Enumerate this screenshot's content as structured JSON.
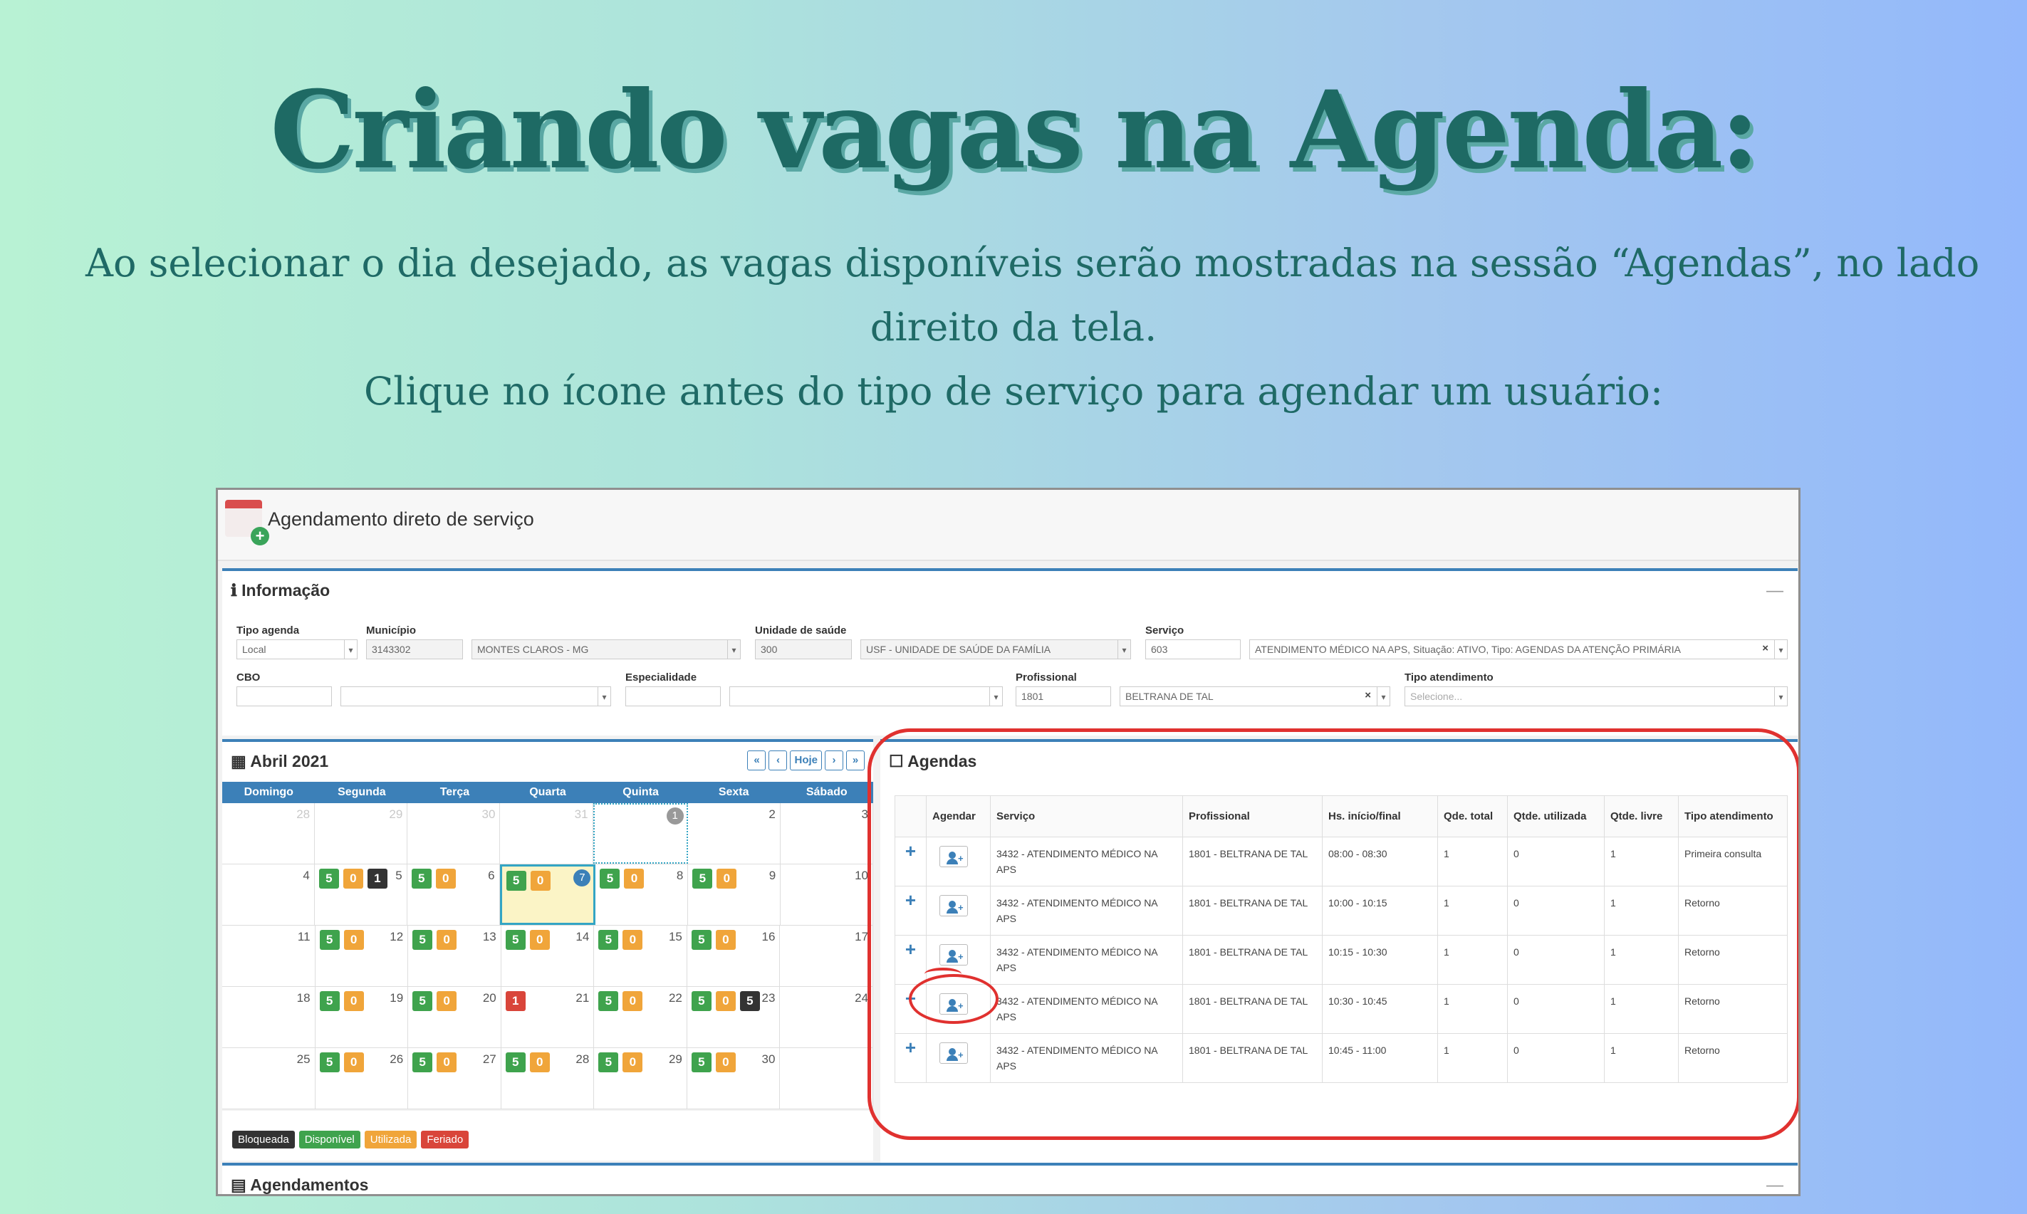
{
  "slide": {
    "headline": "Criando vagas na Agenda:",
    "sub_line1": "Ao selecionar o dia desejado, as vagas disponíveis serão mostradas na sessão “Agendas”, no lado",
    "sub_line2": "direito da tela.",
    "sub_line3": "Clique no ícone antes do tipo de serviço para agendar um usuário:"
  },
  "app": {
    "title": "Agendamento direto de serviço",
    "info": {
      "title": "Informação",
      "tipo_agenda_label": "Tipo agenda",
      "tipo_agenda": "Local",
      "municipio_label": "Município",
      "municipio_code": "3143302",
      "municipio_name": "MONTES CLAROS - MG",
      "unidade_label": "Unidade de saúde",
      "unidade_code": "300",
      "unidade_name": "USF - UNIDADE DE SAÚDE DA FAMÍLIA",
      "servico_label": "Serviço",
      "servico_code": "603",
      "servico_name": "ATENDIMENTO MÉDICO NA APS, Situação: ATIVO, Tipo: AGENDAS DA ATENÇÃO PRIMÁRIA",
      "cbo_label": "CBO",
      "especialidade_label": "Especialidade",
      "profissional_label": "Profissional",
      "profissional_code": "1801",
      "profissional_name": "BELTRANA DE TAL",
      "tipo_atendimento_label": "Tipo atendimento",
      "tipo_atendimento_placeholder": "Selecione..."
    },
    "calendar": {
      "month": "Abril 2021",
      "nav": [
        "«",
        "‹",
        "Hoje",
        "›",
        "»"
      ],
      "weekdays": [
        "Domingo",
        "Segunda",
        "Terça",
        "Quarta",
        "Quinta",
        "Sexta",
        "Sábado"
      ],
      "legend": [
        {
          "label": "Bloqueada",
          "color": "#333333"
        },
        {
          "label": "Disponível",
          "color": "#3fa34d"
        },
        {
          "label": "Utilizada",
          "color": "#f0a53a"
        },
        {
          "label": "Feriado",
          "color": "#d9453a"
        }
      ]
    },
    "agendas": {
      "title": "Agendas",
      "headers": [
        "Agendar",
        "Serviço",
        "Profissional",
        "Hs. início/final",
        "Qde. total",
        "Qtde. utilizada",
        "Qtde. livre",
        "Tipo atendimento"
      ],
      "rows": [
        {
          "servico": "3432 - ATENDIMENTO MÉDICO NA APS",
          "profissional": "1801 - BELTRANA DE TAL",
          "horario": "08:00 - 08:30",
          "total": "1",
          "utilizada": "0",
          "livre": "1",
          "tipo": "Primeira consulta"
        },
        {
          "servico": "3432 - ATENDIMENTO MÉDICO NA APS",
          "profissional": "1801 - BELTRANA DE TAL",
          "horario": "10:00 - 10:15",
          "total": "1",
          "utilizada": "0",
          "livre": "1",
          "tipo": "Retorno"
        },
        {
          "servico": "3432 - ATENDIMENTO MÉDICO NA APS",
          "profissional": "1801 - BELTRANA DE TAL",
          "horario": "10:15 - 10:30",
          "total": "1",
          "utilizada": "0",
          "livre": "1",
          "tipo": "Retorno"
        },
        {
          "servico": "3432 - ATENDIMENTO MÉDICO NA APS",
          "profissional": "1801 - BELTRANA DE TAL",
          "horario": "10:30 - 10:45",
          "total": "1",
          "utilizada": "0",
          "livre": "1",
          "tipo": "Retorno"
        },
        {
          "servico": "3432 - ATENDIMENTO MÉDICO NA APS",
          "profissional": "1801 - BELTRANA DE TAL",
          "horario": "10:45 - 11:00",
          "total": "1",
          "utilizada": "0",
          "livre": "1",
          "tipo": "Retorno"
        }
      ]
    },
    "agendamentos_title": "Agendamentos"
  }
}
